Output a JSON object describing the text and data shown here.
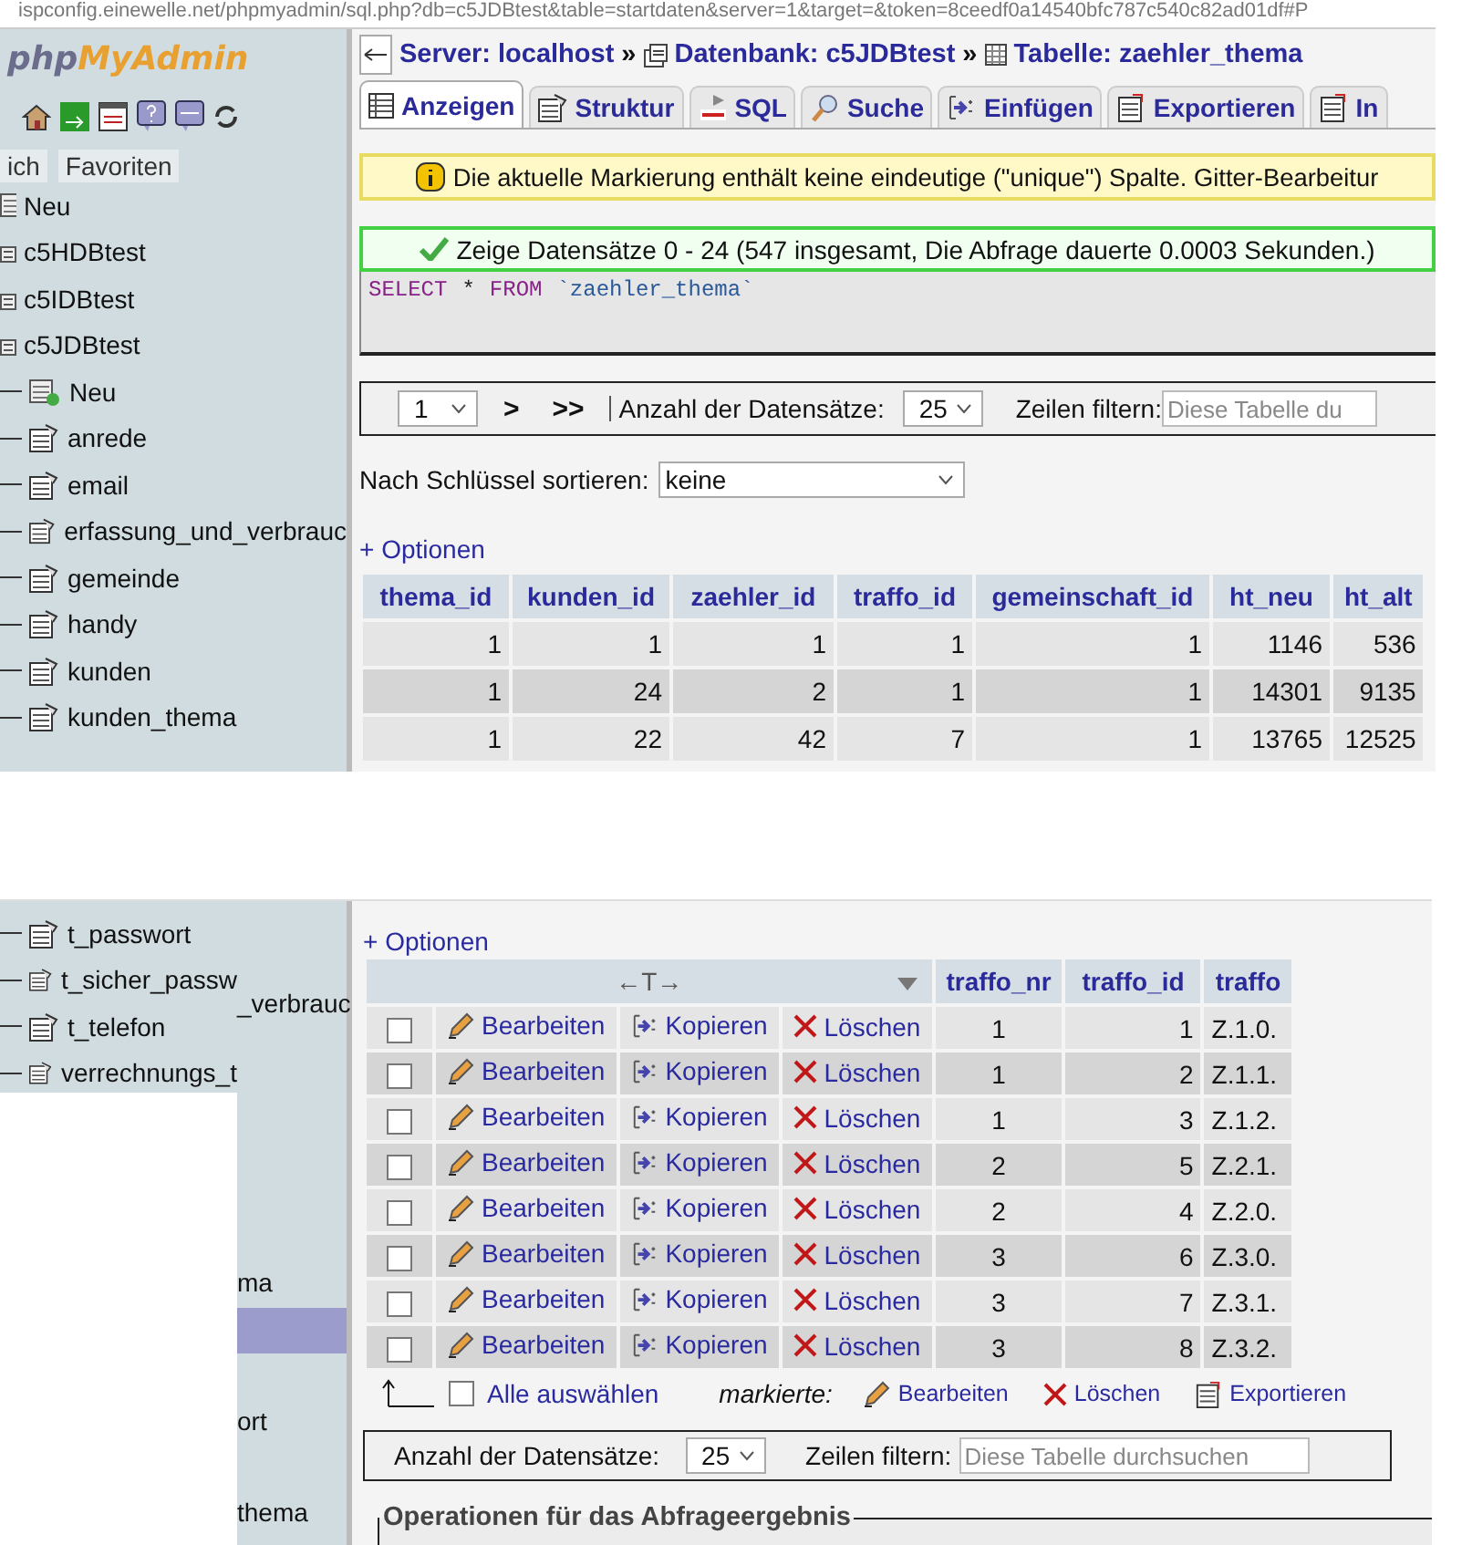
{
  "url_bar": {
    "text": "ispconfig.einewelle.net/phpmyadmin/sql.php?db=c5JDBtest&table=startdaten&server=1&target=&token=8ceedf0a14540bfc787c540c82ad01df#P"
  },
  "sidebar": {
    "logo_left": "php",
    "logo_right": "MyAdmin",
    "tabs": [
      {
        "label": "ich",
        "selected": false
      },
      {
        "label": "Favoriten",
        "selected": false
      }
    ],
    "tree": [
      {
        "label": "Neu",
        "kind": "new"
      },
      {
        "label": "c5HDBtest",
        "kind": "database"
      },
      {
        "label": "c5IDBtest",
        "kind": "database"
      },
      {
        "label": "c5JDBtest",
        "kind": "database",
        "children": [
          {
            "label": "Neu",
            "kind": "new"
          },
          {
            "label": "anrede",
            "kind": "table"
          },
          {
            "label": "email",
            "kind": "table"
          },
          {
            "label": "erfassung_und_verbrauc",
            "kind": "table"
          },
          {
            "label": "gemeinde",
            "kind": "table"
          },
          {
            "label": "handy",
            "kind": "table"
          },
          {
            "label": "kunden",
            "kind": "table"
          },
          {
            "label": "kunden_thema",
            "kind": "table"
          }
        ]
      }
    ]
  },
  "breadcrumb": {
    "separator": "»",
    "items": [
      {
        "label": "Server: localhost",
        "kind": "server"
      },
      {
        "label": "Datenbank: c5JDBtest",
        "kind": "database"
      },
      {
        "label": "Tabelle: zaehler_thema",
        "kind": "table"
      }
    ]
  },
  "tabs": [
    {
      "label": "Anzeigen",
      "kind": "browse",
      "selected": true
    },
    {
      "label": "Struktur",
      "kind": "structure",
      "selected": false
    },
    {
      "label": "SQL",
      "kind": "sql",
      "selected": false
    },
    {
      "label": "Suche",
      "kind": "search",
      "selected": false
    },
    {
      "label": "Einfügen",
      "kind": "insert",
      "selected": false
    },
    {
      "label": "Exportieren",
      "kind": "export",
      "selected": false
    },
    {
      "label": "In",
      "kind": "export",
      "selected": false
    }
  ],
  "notices": [
    {
      "kind": "warning",
      "text": "Die aktuelle Markierung enthält keine eindeutige (\"unique\") Spalte. Gitter-Bearbeitur"
    },
    {
      "kind": "success",
      "text": "Zeige Datensätze 0 - 24 (547 insgesamt, Die Abfrage dauerte 0.0003 Sekunden.)"
    }
  ],
  "sql_query": [
    {
      "kind": "keyword",
      "text": "SELECT"
    },
    {
      "kind": "plain",
      "text": "*"
    },
    {
      "kind": "keyword",
      "text": "FROM"
    },
    {
      "kind": "identifier",
      "text": "`zaehler_thema`"
    }
  ],
  "navigation": {
    "page": "1",
    "next": ">",
    "last": ">>",
    "rows_label": "Anzahl der Datensätze:",
    "rows_value": "25",
    "filter_label": "Zeilen filtern:",
    "filter_placeholder": "Diese Tabelle du"
  },
  "sort": {
    "label": "Nach Schlüssel sortieren:",
    "value": "keine"
  },
  "options_link": "+ Optionen",
  "table": {
    "columns": [
      "thema_id",
      "kunden_id",
      "zaehler_id",
      "traffo_id",
      "gemeinschaft_id",
      "ht_neu",
      "ht_alt"
    ],
    "rows": [
      [
        "1",
        "1",
        "1",
        "1",
        "1",
        "1146",
        "536"
      ],
      [
        "1",
        "24",
        "2",
        "1",
        "1",
        "14301",
        "9135"
      ],
      [
        "1",
        "22",
        "42",
        "7",
        "1",
        "13765",
        "12525"
      ]
    ]
  },
  "lower_sidebar": {
    "items": [
      "t_passwort",
      "t_sicher_passw",
      "t_telefon",
      "verrechnungs_t"
    ],
    "fragments": [
      "_verbrauc",
      "ma",
      "ort",
      "thema"
    ]
  },
  "lower_options_link": "+ Optionen",
  "result_table": {
    "header_arrows": "←T→",
    "columns": [
      "traffo_nr",
      "traffo_id",
      "traffo"
    ],
    "rows": [
      {
        "checked": false,
        "edit": "Bearbeiten",
        "copy": "Kopieren",
        "delete": "Löschen",
        "cells": [
          "1",
          "1",
          "Z.1.0."
        ]
      },
      {
        "checked": false,
        "edit": "Bearbeiten",
        "copy": "Kopieren",
        "delete": "Löschen",
        "cells": [
          "1",
          "2",
          "Z.1.1."
        ]
      },
      {
        "checked": false,
        "edit": "Bearbeiten",
        "copy": "Kopieren",
        "delete": "Löschen",
        "cells": [
          "1",
          "3",
          "Z.1.2."
        ]
      },
      {
        "checked": false,
        "edit": "Bearbeiten",
        "copy": "Kopieren",
        "delete": "Löschen",
        "cells": [
          "2",
          "5",
          "Z.2.1."
        ]
      },
      {
        "checked": false,
        "edit": "Bearbeiten",
        "copy": "Kopieren",
        "delete": "Löschen",
        "cells": [
          "2",
          "4",
          "Z.2.0."
        ]
      },
      {
        "checked": false,
        "edit": "Bearbeiten",
        "copy": "Kopieren",
        "delete": "Löschen",
        "cells": [
          "3",
          "6",
          "Z.3.0."
        ]
      },
      {
        "checked": false,
        "edit": "Bearbeiten",
        "copy": "Kopieren",
        "delete": "Löschen",
        "cells": [
          "3",
          "7",
          "Z.3.1."
        ]
      },
      {
        "checked": false,
        "edit": "Bearbeiten",
        "copy": "Kopieren",
        "delete": "Löschen",
        "cells": [
          "3",
          "8",
          "Z.3.2."
        ]
      }
    ]
  },
  "bulk": {
    "select_all": "Alle auswählen",
    "select_all_checked": false,
    "marked_label": "markierte:",
    "actions": [
      {
        "label": "Bearbeiten",
        "kind": "edit"
      },
      {
        "label": "Löschen",
        "kind": "delete"
      },
      {
        "label": "Exportieren",
        "kind": "export"
      }
    ]
  },
  "lower_navigation": {
    "rows_label": "Anzahl der Datensätze:",
    "rows_value": "25",
    "filter_label": "Zeilen filtern:",
    "filter_placeholder": "Diese Tabelle durchsuchen"
  },
  "operations": {
    "title": "Operationen für das Abfrageergebnis"
  }
}
